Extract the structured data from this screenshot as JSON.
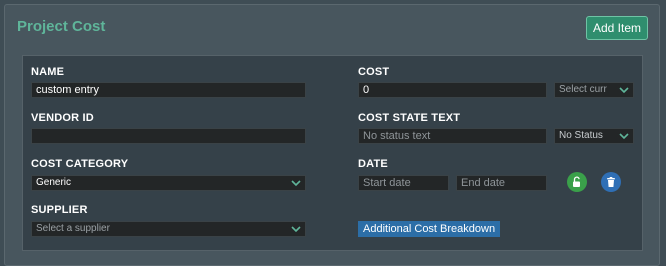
{
  "panel": {
    "title": "Project Cost",
    "add_button": "Add Item"
  },
  "name": {
    "label": "NAME",
    "value": "custom entry"
  },
  "vendor": {
    "label": "VENDOR ID",
    "value": ""
  },
  "category": {
    "label": "COST CATEGORY",
    "value": "Generic"
  },
  "supplier": {
    "label": "SUPPLIER",
    "placeholder": "Select a supplier"
  },
  "cost": {
    "label": "COST",
    "value": "0",
    "currency_placeholder": "Select curr"
  },
  "state": {
    "label": "COST STATE TEXT",
    "placeholder": "No status text",
    "status_value": "No Status"
  },
  "date": {
    "label": "DATE",
    "start_placeholder": "Start date",
    "end_placeholder": "End date"
  },
  "breakdown": {
    "label": "Additional Cost Breakdown"
  },
  "colors": {
    "accent": "#5fb59a",
    "add_button": "#2f8e6e",
    "lock": "#3aa04a",
    "delete": "#2f6fb5",
    "link": "#2c6ea7"
  },
  "icons": {
    "lock": "unlock-icon",
    "delete": "trash-icon",
    "dropdown": "chevron-down-icon"
  }
}
